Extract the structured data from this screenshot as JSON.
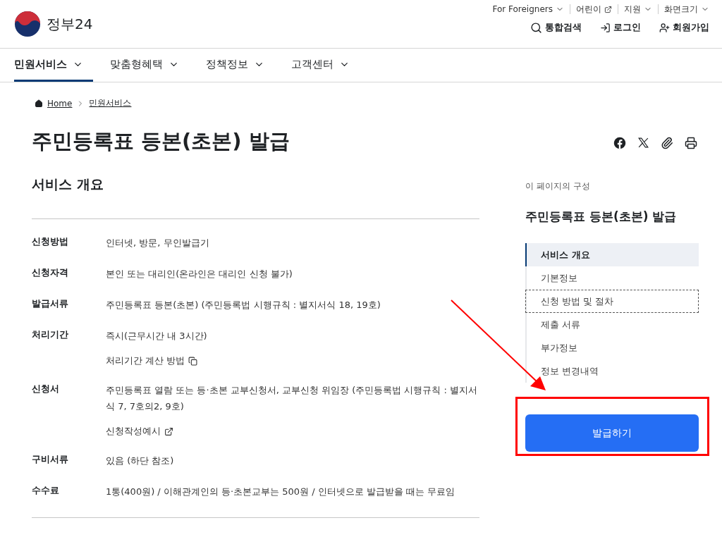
{
  "logo": {
    "text": "정부24"
  },
  "utility_links": [
    {
      "label": "For Foreigners",
      "kind": "menu"
    },
    {
      "label": "어린이",
      "kind": "external"
    },
    {
      "label": "지원",
      "kind": "menu"
    },
    {
      "label": "화면크기",
      "kind": "menu"
    }
  ],
  "header_actions": [
    {
      "label": "통합검색",
      "kind": "search"
    },
    {
      "label": "로그인",
      "kind": "login"
    },
    {
      "label": "회원가입",
      "kind": "signup"
    }
  ],
  "nav": [
    {
      "label": "민원서비스",
      "selected": true
    },
    {
      "label": "맞춤형혜택",
      "selected": false
    },
    {
      "label": "정책정보",
      "selected": false
    },
    {
      "label": "고객센터",
      "selected": false
    }
  ],
  "breadcrumb": [
    "Home",
    "민원서비스"
  ],
  "title": "주민등록표 등본(초본) 발급",
  "section_title": "서비스 개요",
  "rows": [
    {
      "label": "신청방법",
      "lines": [
        {
          "text": "인터넷, 방문, 무인발급기",
          "kind": "text"
        }
      ]
    },
    {
      "label": "신청자격",
      "lines": [
        {
          "text": "본인 또는 대리인(온라인은 대리인 신청 불가)",
          "kind": "text"
        }
      ]
    },
    {
      "label": "발급서류",
      "lines": [
        {
          "text": "주민등록표 등본(초본) (주민등록법 시행규칙 : 별지서식 18, 19호)",
          "kind": "text"
        }
      ]
    },
    {
      "label": "처리기간",
      "lines": [
        {
          "text": "즉시(근무시간 내 3시간)",
          "kind": "text"
        },
        {
          "text": "처리기간 계산 방법",
          "kind": "popup"
        }
      ]
    },
    {
      "label": "신청서",
      "lines": [
        {
          "text": "주민등록표 열람 또는 등·초본 교부신청서, 교부신청 위임장 (주민등록법 시행규칙 : 별지서식 7, 7호의2, 9호)",
          "kind": "text"
        },
        {
          "text": "신청작성예시",
          "kind": "external"
        }
      ]
    },
    {
      "label": "구비서류",
      "lines": [
        {
          "text": "있음 (하단 참조)",
          "kind": "text"
        }
      ]
    },
    {
      "label": "수수료",
      "lines": [
        {
          "text": "1통(400원) / 이해관계인의 등·초본교부는 500원 / 인터넷으로 발급받을 때는 무료임",
          "kind": "text"
        }
      ]
    }
  ],
  "toc": {
    "caption": "이 페이지의 구성",
    "title": "주민등록표 등본(초본) 발급",
    "items": [
      {
        "label": "서비스 개요",
        "selected": true,
        "focused": false
      },
      {
        "label": "기본정보",
        "selected": false,
        "focused": false
      },
      {
        "label": "신청 방법 및 절차",
        "selected": false,
        "focused": true
      },
      {
        "label": "제출 서류",
        "selected": false,
        "focused": false
      },
      {
        "label": "부가정보",
        "selected": false,
        "focused": false
      },
      {
        "label": "정보 변경내역",
        "selected": false,
        "focused": false
      }
    ]
  },
  "issue_button": {
    "label": "발급하기",
    "highlighted": true
  }
}
